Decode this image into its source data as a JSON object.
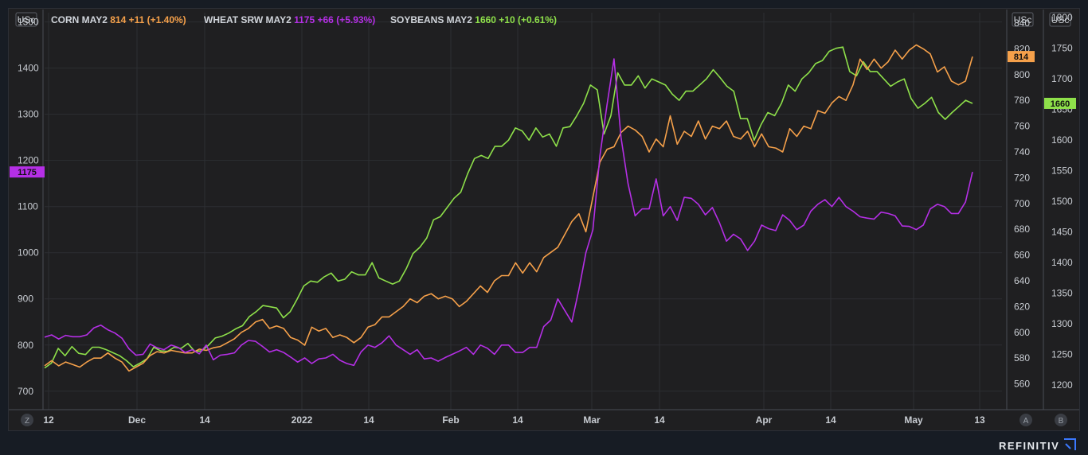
{
  "brand": {
    "name": "REFINITIV",
    "icon": "refinitiv-logo-icon"
  },
  "controls": {
    "left_button": "Z",
    "right_a": "A",
    "right_b": "B"
  },
  "chart_data": {
    "type": "line",
    "unit_label_left": "USc",
    "unit_label_right_a": "USc",
    "unit_label_right_b": "USc",
    "legend": [
      {
        "name": "CORN MAY2",
        "last": "814",
        "change": "+11 (+1.40%)",
        "color": "#f5a04a"
      },
      {
        "name": "WHEAT SRW MAY2",
        "last": "1175",
        "change": "+66 (+5.93%)",
        "color": "#b52fe6"
      },
      {
        "name": "SOYBEANS MAY2",
        "last": "1660",
        "change": "+10 (+0.61%)",
        "color": "#8ee04a"
      }
    ],
    "x_tick_labels": [
      "12",
      "Dec",
      "14",
      "2022",
      "14",
      "Feb",
      "14",
      "Mar",
      "14",
      "Apr",
      "14",
      "May",
      "13"
    ],
    "axes": {
      "left": {
        "range": [
          660,
          1520
        ],
        "ticks": [
          700,
          800,
          900,
          1000,
          1100,
          1200,
          1300,
          1400,
          1500
        ]
      },
      "right_a": {
        "range": [
          540,
          848
        ],
        "ticks": [
          560,
          580,
          600,
          620,
          640,
          660,
          680,
          700,
          720,
          740,
          760,
          780,
          800,
          820,
          840
        ]
      },
      "right_b": {
        "range": [
          1160,
          1808
        ],
        "ticks": [
          1200,
          1250,
          1300,
          1350,
          1400,
          1450,
          1500,
          1550,
          1600,
          1650,
          1700,
          1750,
          1800
        ]
      }
    },
    "grid": true,
    "series": [
      {
        "name": "WHEAT SRW MAY2",
        "axis": "left",
        "last_label": "1175",
        "color": "#b52fe6",
        "values": [
          817,
          822,
          813,
          821,
          818,
          818,
          822,
          837,
          843,
          833,
          826,
          815,
          792,
          778,
          780,
          802,
          794,
          790,
          800,
          795,
          784,
          790,
          781,
          800,
          768,
          778,
          780,
          783,
          800,
          810,
          808,
          797,
          785,
          790,
          784,
          774,
          763,
          772,
          760,
          770,
          772,
          780,
          767,
          760,
          756,
          785,
          800,
          795,
          805,
          820,
          800,
          790,
          780,
          790,
          770,
          772,
          765,
          773,
          780,
          787,
          795,
          780,
          800,
          793,
          780,
          800,
          800,
          784,
          784,
          795,
          795,
          840,
          854,
          900,
          875,
          850,
          920,
          1000,
          1050,
          1210,
          1320,
          1420,
          1250,
          1150,
          1080,
          1095,
          1095,
          1160,
          1080,
          1100,
          1070,
          1120,
          1118,
          1105,
          1082,
          1098,
          1065,
          1025,
          1040,
          1030,
          1005,
          1025,
          1060,
          1052,
          1048,
          1082,
          1070,
          1050,
          1060,
          1090,
          1105,
          1115,
          1100,
          1120,
          1100,
          1090,
          1078,
          1075,
          1073,
          1088,
          1085,
          1080,
          1058,
          1057,
          1050,
          1060,
          1095,
          1105,
          1100,
          1085,
          1085,
          1110,
          1175
        ]
      },
      {
        "name": "CORN MAY2",
        "axis": "right_a",
        "last_label": "814",
        "color": "#f5a04a",
        "values": [
          574,
          578,
          574,
          577,
          575,
          573,
          577,
          580,
          580,
          584,
          580,
          577,
          570,
          573,
          576,
          582,
          585,
          584,
          586,
          585,
          584,
          584,
          587,
          586,
          588,
          589,
          592,
          595,
          600,
          603,
          608,
          610,
          603,
          605,
          603,
          596,
          594,
          590,
          604,
          601,
          603,
          596,
          598,
          596,
          592,
          596,
          604,
          606,
          612,
          612,
          616,
          620,
          626,
          623,
          628,
          630,
          626,
          628,
          626,
          620,
          624,
          630,
          636,
          631,
          640,
          644,
          644,
          654,
          646,
          654,
          647,
          658,
          662,
          666,
          676,
          686,
          692,
          678,
          705,
          732,
          742,
          744,
          755,
          760,
          757,
          752,
          740,
          750,
          744,
          768,
          746,
          756,
          752,
          764,
          750,
          760,
          758,
          764,
          752,
          750,
          756,
          744,
          754,
          744,
          743,
          740,
          758,
          752,
          760,
          758,
          772,
          770,
          778,
          783,
          780,
          792,
          812,
          804,
          812,
          805,
          810,
          819,
          812,
          819,
          823,
          820,
          816,
          802,
          806,
          795,
          792,
          795,
          814
        ]
      },
      {
        "name": "SOYBEANS MAY2",
        "axis": "right_b",
        "last_label": "1660",
        "color": "#8ee04a",
        "values": [
          1228,
          1236,
          1260,
          1248,
          1263,
          1252,
          1250,
          1262,
          1262,
          1258,
          1253,
          1248,
          1240,
          1230,
          1236,
          1243,
          1262,
          1256,
          1255,
          1262,
          1260,
          1268,
          1255,
          1256,
          1265,
          1277,
          1280,
          1285,
          1292,
          1297,
          1312,
          1320,
          1330,
          1328,
          1326,
          1310,
          1320,
          1340,
          1362,
          1370,
          1368,
          1377,
          1383,
          1370,
          1373,
          1385,
          1380,
          1380,
          1400,
          1375,
          1370,
          1365,
          1370,
          1390,
          1415,
          1425,
          1440,
          1470,
          1475,
          1490,
          1505,
          1515,
          1545,
          1570,
          1575,
          1570,
          1590,
          1590,
          1600,
          1620,
          1615,
          1600,
          1620,
          1605,
          1610,
          1590,
          1620,
          1622,
          1640,
          1660,
          1690,
          1682,
          1610,
          1640,
          1710,
          1690,
          1690,
          1705,
          1685,
          1700,
          1695,
          1690,
          1675,
          1665,
          1680,
          1680,
          1690,
          1700,
          1715,
          1702,
          1688,
          1680,
          1635,
          1635,
          1600,
          1625,
          1645,
          1640,
          1660,
          1690,
          1680,
          1700,
          1710,
          1725,
          1730,
          1745,
          1750,
          1752,
          1712,
          1705,
          1728,
          1712,
          1712,
          1700,
          1688,
          1695,
          1700,
          1668,
          1652,
          1660,
          1670,
          1645,
          1634,
          1645,
          1655,
          1665,
          1660
        ]
      }
    ]
  }
}
